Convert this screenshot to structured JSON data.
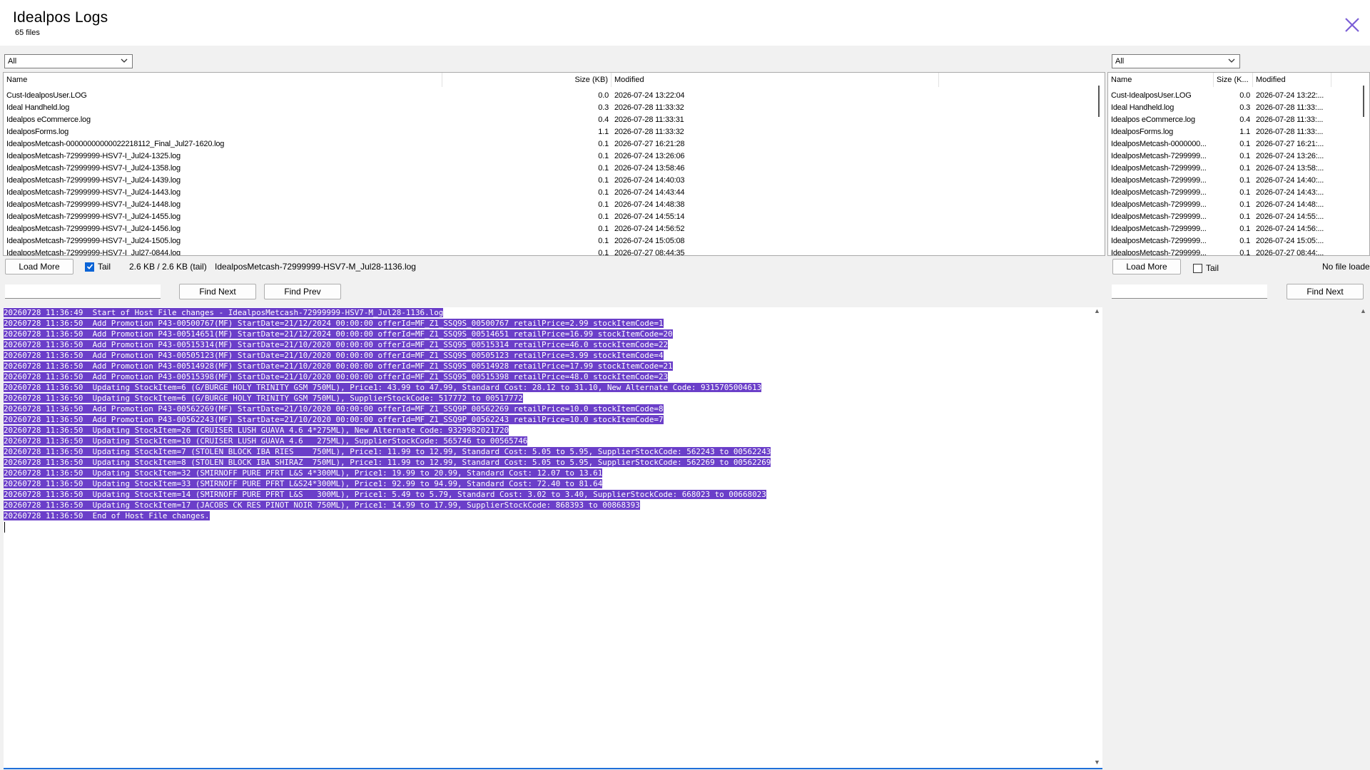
{
  "header": {
    "title": "Idealpos Logs",
    "file_count": "65 files"
  },
  "left": {
    "filter_value": "All",
    "columns": {
      "name": "Name",
      "size": "Size (KB)",
      "modified": "Modified"
    },
    "files": [
      {
        "name": "Cust-IdealposUser.LOG",
        "size": "0.0",
        "modified": "2026-07-24 13:22:04"
      },
      {
        "name": "Ideal Handheld.log",
        "size": "0.3",
        "modified": "2026-07-28 11:33:32"
      },
      {
        "name": "Idealpos eCommerce.log",
        "size": "0.4",
        "modified": "2026-07-28 11:33:31"
      },
      {
        "name": "IdealposForms.log",
        "size": "1.1",
        "modified": "2026-07-28 11:33:32"
      },
      {
        "name": "IdealposMetcash-00000000000022218112_Final_Jul27-1620.log",
        "size": "0.1",
        "modified": "2026-07-27 16:21:28"
      },
      {
        "name": "IdealposMetcash-72999999-HSV7-I_Jul24-1325.log",
        "size": "0.1",
        "modified": "2026-07-24 13:26:06"
      },
      {
        "name": "IdealposMetcash-72999999-HSV7-I_Jul24-1358.log",
        "size": "0.1",
        "modified": "2026-07-24 13:58:46"
      },
      {
        "name": "IdealposMetcash-72999999-HSV7-I_Jul24-1439.log",
        "size": "0.1",
        "modified": "2026-07-24 14:40:03"
      },
      {
        "name": "IdealposMetcash-72999999-HSV7-I_Jul24-1443.log",
        "size": "0.1",
        "modified": "2026-07-24 14:43:44"
      },
      {
        "name": "IdealposMetcash-72999999-HSV7-I_Jul24-1448.log",
        "size": "0.1",
        "modified": "2026-07-24 14:48:38"
      },
      {
        "name": "IdealposMetcash-72999999-HSV7-I_Jul24-1455.log",
        "size": "0.1",
        "modified": "2026-07-24 14:55:14"
      },
      {
        "name": "IdealposMetcash-72999999-HSV7-I_Jul24-1456.log",
        "size": "0.1",
        "modified": "2026-07-24 14:56:52"
      },
      {
        "name": "IdealposMetcash-72999999-HSV7-I_Jul24-1505.log",
        "size": "0.1",
        "modified": "2026-07-24 15:05:08"
      },
      {
        "name": "IdealposMetcash-72999999-HSV7-I_Jul27-0844.log",
        "size": "0.1",
        "modified": "2026-07-27 08:44:35"
      }
    ],
    "load_more": "Load More",
    "tail_label": "Tail",
    "tail_checked": true,
    "size_info": "2.6 KB / 2.6 KB (tail)",
    "loaded_file": "IdealposMetcash-72999999-HSV7-M_Jul28-1136.log",
    "search_value": "",
    "find_next": "Find Next",
    "find_prev": "Find Prev",
    "log_lines": [
      "20260728 11:36:49  Start of Host File changes - IdealposMetcash-72999999-HSV7-M_Jul28-1136.log",
      "20260728 11:36:50  Add Promotion P43-00500767(MF) StartDate=21/12/2024 00:00:00 offerId=MF_Z1_SSQ9S_00500767 retailPrice=2.99 stockItemCode=1",
      "20260728 11:36:50  Add Promotion P43-00514651(MF) StartDate=21/12/2024 00:00:00 offerId=MF_Z1_SSQ9S_00514651 retailPrice=16.99 stockItemCode=20",
      "20260728 11:36:50  Add Promotion P43-00515314(MF) StartDate=21/10/2020 00:00:00 offerId=MF_Z1_SSQ9S_00515314 retailPrice=46.0 stockItemCode=22",
      "20260728 11:36:50  Add Promotion P43-00505123(MF) StartDate=21/10/2020 00:00:00 offerId=MF_Z1_SSQ9S_00505123 retailPrice=3.99 stockItemCode=4",
      "20260728 11:36:50  Add Promotion P43-00514928(MF) StartDate=21/10/2020 00:00:00 offerId=MF_Z1_SSQ9S_00514928 retailPrice=17.99 stockItemCode=21",
      "20260728 11:36:50  Add Promotion P43-00515398(MF) StartDate=21/10/2020 00:00:00 offerId=MF_Z1_SSQ9S_00515398 retailPrice=48.0 stockItemCode=23",
      "20260728 11:36:50  Updating StockItem=6 (G/BURGE HOLY TRINITY GSM 750ML), Price1: 43.99 to 47.99, Standard Cost: 28.12 to 31.10, New Alternate Code: 9315705004613",
      "20260728 11:36:50  Updating StockItem=6 (G/BURGE HOLY TRINITY GSM 750ML), SupplierStockCode: 517772 to 00517772",
      "20260728 11:36:50  Add Promotion P43-00562269(MF) StartDate=21/10/2020 00:00:00 offerId=MF_Z1_SSQ9P_00562269 retailPrice=10.0 stockItemCode=8",
      "20260728 11:36:50  Add Promotion P43-00562243(MF) StartDate=21/10/2020 00:00:00 offerId=MF_Z1_SSQ9P_00562243 retailPrice=10.0 stockItemCode=7",
      "20260728 11:36:50  Updating StockItem=26 (CRUISER LUSH GUAVA 4.6 4*275ML), New Alternate Code: 9329982021720",
      "20260728 11:36:50  Updating StockItem=10 (CRUISER LUSH GUAVA 4.6   275ML), SupplierStockCode: 565746 to 00565746",
      "20260728 11:36:50  Updating StockItem=7 (STOLEN BLOCK IBA RIES    750ML), Price1: 11.99 to 12.99, Standard Cost: 5.05 to 5.95, SupplierStockCode: 562243 to 00562243",
      "20260728 11:36:50  Updating StockItem=8 (STOLEN BLOCK IBA SHIRAZ  750ML), Price1: 11.99 to 12.99, Standard Cost: 5.05 to 5.95, SupplierStockCode: 562269 to 00562269",
      "20260728 11:36:50  Updating StockItem=32 (SMIRNOFF PURE PFRT L&S 4*300ML), Price1: 19.99 to 20.99, Standard Cost: 12.07 to 13.61",
      "20260728 11:36:50  Updating StockItem=33 (SMIRNOFF PURE PFRT L&S24*300ML), Price1: 92.99 to 94.99, Standard Cost: 72.40 to 81.64",
      "20260728 11:36:50  Updating StockItem=14 (SMIRNOFF PURE PFRT L&S   300ML), Price1: 5.49 to 5.79, Standard Cost: 3.02 to 3.40, SupplierStockCode: 668023 to 00668023",
      "20260728 11:36:50  Updating StockItem=17 (JACOBS CK RES PINOT NOIR 750ML), Price1: 14.99 to 17.99, SupplierStockCode: 868393 to 00868393",
      "20260728 11:36:50  End of Host File changes."
    ]
  },
  "right": {
    "filter_value": "All",
    "columns": {
      "name": "Name",
      "size": "Size (K...",
      "modified": "Modified"
    },
    "files": [
      {
        "name": "Cust-IdealposUser.LOG",
        "size": "0.0",
        "modified": "2026-07-24 13:22:..."
      },
      {
        "name": "Ideal Handheld.log",
        "size": "0.3",
        "modified": "2026-07-28 11:33:..."
      },
      {
        "name": "Idealpos eCommerce.log",
        "size": "0.4",
        "modified": "2026-07-28 11:33:..."
      },
      {
        "name": "IdealposForms.log",
        "size": "1.1",
        "modified": "2026-07-28 11:33:..."
      },
      {
        "name": "IdealposMetcash-0000000...",
        "size": "0.1",
        "modified": "2026-07-27 16:21:..."
      },
      {
        "name": "IdealposMetcash-7299999...",
        "size": "0.1",
        "modified": "2026-07-24 13:26:..."
      },
      {
        "name": "IdealposMetcash-7299999...",
        "size": "0.1",
        "modified": "2026-07-24 13:58:..."
      },
      {
        "name": "IdealposMetcash-7299999...",
        "size": "0.1",
        "modified": "2026-07-24 14:40:..."
      },
      {
        "name": "IdealposMetcash-7299999...",
        "size": "0.1",
        "modified": "2026-07-24 14:43:..."
      },
      {
        "name": "IdealposMetcash-7299999...",
        "size": "0.1",
        "modified": "2026-07-24 14:48:..."
      },
      {
        "name": "IdealposMetcash-7299999...",
        "size": "0.1",
        "modified": "2026-07-24 14:55:..."
      },
      {
        "name": "IdealposMetcash-7299999...",
        "size": "0.1",
        "modified": "2026-07-24 14:56:..."
      },
      {
        "name": "IdealposMetcash-7299999...",
        "size": "0.1",
        "modified": "2026-07-24 15:05:..."
      },
      {
        "name": "IdealposMetcash-7299999...",
        "size": "0.1",
        "modified": "2026-07-27 08:44:..."
      }
    ],
    "load_more": "Load More",
    "tail_label": "Tail",
    "tail_checked": false,
    "status": "No file loaded",
    "search_value": "",
    "find_next": "Find Next"
  },
  "colors": {
    "accent": "#7b5fd6",
    "selection": "#6b3fc9",
    "checkbox": "#0a63d6",
    "panel_background": "#f1f1f1"
  },
  "icons": {
    "close": "close-icon",
    "dropdown": "chevron-down-icon",
    "check": "checkmark-icon",
    "scroll_up": "scroll-up-icon",
    "scroll_down": "scroll-down-icon"
  }
}
